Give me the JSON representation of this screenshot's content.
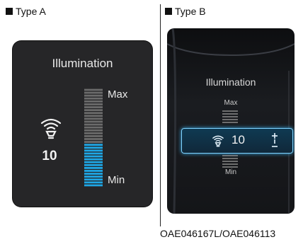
{
  "type_a": {
    "label": "Type A",
    "title": "Illumination",
    "value": "10",
    "max_label": "Max",
    "min_label": "Min",
    "level_fraction": 0.45,
    "active_color": "#1ea7e6",
    "inactive_color": "#6b6b6b",
    "icon": "lightbulb-icon"
  },
  "type_b": {
    "label": "Type B",
    "title": "Illumination",
    "value": "10",
    "max_label": "Max",
    "min_label": "Min",
    "highlight_color": "#7fd3ff",
    "icon": "lightbulb-icon"
  },
  "footer": {
    "code": "OAE046167L/OAE046113"
  }
}
